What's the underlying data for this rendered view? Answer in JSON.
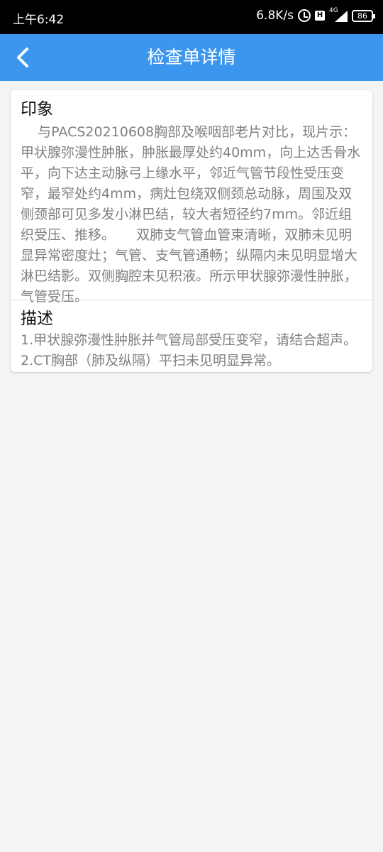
{
  "status_bar": {
    "time": "上午6:42",
    "net_speed": "6.8K/s",
    "network": "4G",
    "battery": "86"
  },
  "app_bar": {
    "title": "检查单详情",
    "background": "#3d96ee"
  },
  "report": {
    "impression": {
      "title": "印象",
      "text": "    与PACS20210608胸部及喉咽部老片对比，现片示：甲状腺弥漫性肿胀，肿胀最厚处约40mm，向上达舌骨水平，向下达主动脉弓上缘水平，邻近气管节段性受压变窄，最窄处约4mm，病灶包绕双侧颈总动脉，周围及双侧颈部可见多发小淋巴结，较大者短径约7mm。邻近组织受压、推移。     双肺支气管血管束清晰，双肺未见明显异常密度灶；气管、支气管通畅；纵隔内未见明显增大淋巴结影。双侧胸腔未见积液。所示甲状腺弥漫性肿胀，气管受压。"
    },
    "description": {
      "title": "描述",
      "text": "1.甲状腺弥漫性肿胀并气管局部受压变窄，请结合超声。2.CT胸部（肺及纵隔）平扫未见明显异常。"
    }
  }
}
